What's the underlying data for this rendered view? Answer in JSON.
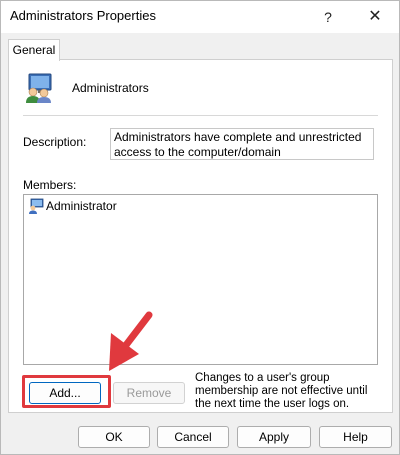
{
  "window": {
    "title": "Administrators Properties",
    "help_label": "?",
    "close_label": "✕"
  },
  "tabs": [
    {
      "label": "General"
    }
  ],
  "general": {
    "group_name": "Administrators",
    "description_label": "Description:",
    "description_value": "Administrators have complete and unrestricted access to the computer/domain",
    "members_label": "Members:",
    "members": [
      {
        "name": "Administrator",
        "icon": "user-icon"
      }
    ],
    "add_label": "Add...",
    "remove_label": "Remove",
    "note": "Changes to a user's group membership are not effective until the next time the user logs on."
  },
  "footer": {
    "ok_label": "OK",
    "cancel_label": "Cancel",
    "apply_label": "Apply",
    "help_label": "Help"
  },
  "annotation": {
    "highlight_color": "#e0393e",
    "arrow_color": "#e0393e"
  }
}
